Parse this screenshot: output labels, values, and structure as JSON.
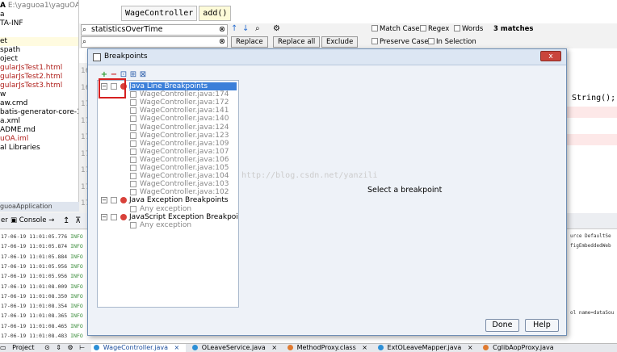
{
  "window": {
    "title_path": "E:\\yaguoa1\\yaguOA"
  },
  "project_tree": [
    "A",
    "a",
    "TA-INF",
    "",
    "et",
    "spath",
    "oject",
    "gularJsTest1.html",
    "gularJsTest2.html",
    "gularJsTest3.html",
    "w",
    "aw.cmd",
    "batis-generator-core-1.",
    "a.xml",
    "ADME.md",
    "uOA.iml",
    "al Libraries"
  ],
  "breadcrumb": [
    "WageController",
    "add()"
  ],
  "find": {
    "search_value": "statisticsOverTime",
    "replace_value": "",
    "replace_label": "Replace",
    "replace_all_label": "Replace all",
    "exclude_label": "Exclude",
    "match_case": "Match Case",
    "regex": "Regex",
    "words": "Words",
    "preserve_case": "Preserve Case",
    "in_selection": "In Selection",
    "matches": "3 matches"
  },
  "editor": {
    "gutter": [
      "16",
      "16",
      "17",
      "17",
      "17",
      "17",
      "17",
      "17",
      "17",
      "17"
    ],
    "right_code": "String();"
  },
  "dialog": {
    "title": "Breakpoints",
    "close": "x",
    "toolbar": [
      "+",
      "−",
      "⊡",
      "⊞",
      "⊠"
    ],
    "tree": {
      "java_line": "Java Line Breakpoints",
      "lines": [
        "WageController.java:174",
        "WageController.java:172",
        "WageController.java:141",
        "WageController.java:140",
        "WageController.java:124",
        "WageController.java:123",
        "WageController.java:109",
        "WageController.java:107",
        "WageController.java:106",
        "WageController.java:105",
        "WageController.java:104",
        "WageController.java:103",
        "WageController.java:102"
      ],
      "java_exception": "Java Exception Breakpoints",
      "any_exception_1": "Any exception",
      "js_exception": "JavaScript Exception Breakpoi",
      "any_exception_2": "Any exception"
    },
    "select_message": "Select a breakpoint",
    "watermark": "http://blog.csdn.net/yanzili",
    "done_label": "Done",
    "help_label": "Help"
  },
  "run_panel": {
    "header": "guoaApplication",
    "tab_server": "er",
    "tab_console": "Console",
    "logs": [
      {
        "time": "17-06-19 11:01:05.776",
        "level": "INFO"
      },
      {
        "time": "17-06-19 11:01:05.874",
        "level": "INFO"
      },
      {
        "time": "17-06-19 11:01:05.884",
        "level": "INFO"
      },
      {
        "time": "17-06-19 11:01:05.956",
        "level": "INFO"
      },
      {
        "time": "17-06-19 11:01:05.956",
        "level": "INFO"
      },
      {
        "time": "17-06-19 11:01:08.009",
        "level": "INFO"
      },
      {
        "time": "17-06-19 11:01:08.350",
        "level": "INFO"
      },
      {
        "time": "17-06-19 11:01:08.354",
        "level": "INFO"
      },
      {
        "time": "17-06-19 11:01:08.365",
        "level": "INFO"
      },
      {
        "time": "17-06-19 11:01:08.465",
        "level": "INFO"
      },
      {
        "time": "17-06-19 11:01:08.483",
        "level": "INFO"
      }
    ],
    "right_snippets": [
      "urce DefaultSe",
      "figEmbeddedWeb",
      "ol name=dataSou"
    ]
  },
  "bottom_tabs": {
    "project": "Project",
    "files": [
      "WageController.java",
      "OLeaveService.java",
      "MethodProxy.class",
      "ExtOLeaveMapper.java",
      "CglibAopProxy.java"
    ]
  }
}
